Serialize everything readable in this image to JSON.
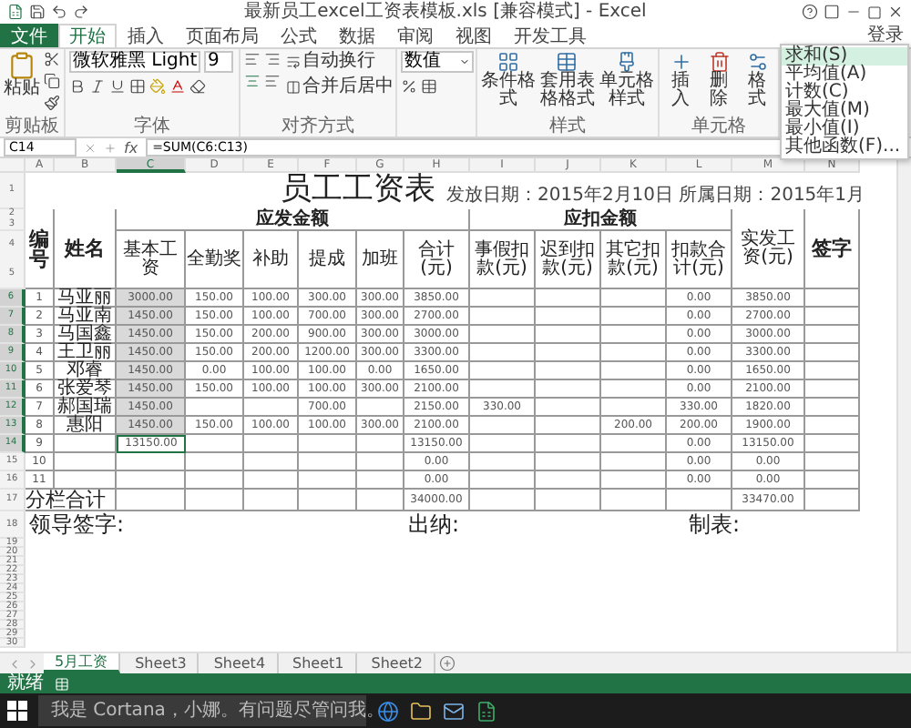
{
  "title_bar": {
    "title": "最新员工excel工资表模板.xls [兼容模式] - Excel",
    "login": "登录"
  },
  "tabs": [
    {
      "label": "文件",
      "kind": "file",
      "selected": false
    },
    {
      "label": "开始",
      "kind": "tab",
      "selected": true
    },
    {
      "label": "插入",
      "kind": "tab",
      "selected": false
    },
    {
      "label": "页面布局",
      "kind": "tab",
      "selected": false
    },
    {
      "label": "公式",
      "kind": "tab",
      "selected": false
    },
    {
      "label": "数据",
      "kind": "tab",
      "selected": false
    },
    {
      "label": "审阅",
      "kind": "tab",
      "selected": false
    },
    {
      "label": "视图",
      "kind": "tab",
      "selected": false
    },
    {
      "label": "开发工具",
      "kind": "tab",
      "selected": false
    }
  ],
  "ribbon": {
    "groups": [
      {
        "kind": "clipboard",
        "label": "剪贴板",
        "buttons": [
          "粘贴"
        ]
      },
      {
        "kind": "font",
        "label": "字体",
        "font_name": "微软雅黑 Light",
        "font_size": "9"
      },
      {
        "kind": "alignment",
        "label": "对齐方式",
        "buttons": [
          "自动换行",
          "合并后居中"
        ]
      },
      {
        "kind": "number",
        "number_format": "数值"
      },
      {
        "kind": "styles",
        "label": "样式",
        "buttons": [
          "条件格式",
          "套用表格格式",
          "单元格样式"
        ]
      },
      {
        "kind": "cells",
        "label": "单元格",
        "buttons": [
          "插入",
          "删除",
          "格式"
        ]
      }
    ]
  },
  "autosum_menu": {
    "items": [
      {
        "label": "求和(S)",
        "selected": true
      },
      {
        "label": "平均值(A)",
        "selected": false
      },
      {
        "label": "计数(C)",
        "selected": false
      },
      {
        "label": "最大值(M)",
        "selected": false
      },
      {
        "label": "最小值(I)",
        "selected": false
      },
      {
        "label": "其他函数(F)...",
        "selected": false
      }
    ]
  },
  "formula_bar": {
    "name_box": "C14",
    "fx_label": "fx",
    "formula": "=SUM(C6:C13)"
  },
  "columns": [
    {
      "label": "A",
      "selected": false
    },
    {
      "label": "B",
      "selected": false
    },
    {
      "label": "C",
      "selected": true
    },
    {
      "label": "D",
      "selected": false
    },
    {
      "label": "E",
      "selected": false
    },
    {
      "label": "F",
      "selected": false
    },
    {
      "label": "G",
      "selected": false
    },
    {
      "label": "H",
      "selected": false
    },
    {
      "label": "I",
      "selected": false
    },
    {
      "label": "J",
      "selected": false
    },
    {
      "label": "K",
      "selected": false
    },
    {
      "label": "L",
      "selected": false
    },
    {
      "label": "M",
      "selected": false
    },
    {
      "label": "N",
      "selected": false
    }
  ],
  "sheet": {
    "title": "员工工资表",
    "dates": "发放日期：2015年2月10日  所属日期：2015年1月",
    "header_row_numbers": [
      "1",
      "2",
      "3",
      "4",
      "5"
    ],
    "id_header": "编号",
    "name_header": "姓名",
    "group_headers": [
      "应发金额",
      "应扣金额"
    ],
    "headers": [
      "基本工资",
      "全勤奖",
      "补助",
      "提成",
      "加班",
      "合计(元)",
      "事假扣款(元)",
      "迟到扣款(元)",
      "其它扣款(元)",
      "扣款合计(元)"
    ],
    "net_header": "实发工资(元)",
    "sign_header": "签字",
    "rows": [
      {
        "row": "6",
        "selected": true,
        "active": false,
        "cells": [
          "1",
          "马亚丽",
          "3000.00",
          "150.00",
          "100.00",
          "300.00",
          "300.00",
          "3850.00",
          "",
          "",
          "",
          "0.00",
          "3850.00"
        ]
      },
      {
        "row": "7",
        "selected": true,
        "active": false,
        "cells": [
          "2",
          "马亚南",
          "1450.00",
          "150.00",
          "100.00",
          "700.00",
          "300.00",
          "2700.00",
          "",
          "",
          "",
          "0.00",
          "2700.00"
        ]
      },
      {
        "row": "8",
        "selected": true,
        "active": false,
        "cells": [
          "3",
          "马国鑫",
          "1450.00",
          "150.00",
          "200.00",
          "900.00",
          "300.00",
          "3000.00",
          "",
          "",
          "",
          "0.00",
          "3000.00"
        ]
      },
      {
        "row": "9",
        "selected": true,
        "active": false,
        "cells": [
          "4",
          "王卫丽",
          "1450.00",
          "150.00",
          "200.00",
          "1200.00",
          "300.00",
          "3300.00",
          "",
          "",
          "",
          "0.00",
          "3300.00"
        ]
      },
      {
        "row": "10",
        "selected": true,
        "active": false,
        "cells": [
          "5",
          "邓睿",
          "1450.00",
          "0.00",
          "100.00",
          "100.00",
          "0.00",
          "1650.00",
          "",
          "",
          "",
          "0.00",
          "1650.00"
        ]
      },
      {
        "row": "11",
        "selected": true,
        "active": false,
        "cells": [
          "6",
          "张爱琴",
          "1450.00",
          "150.00",
          "100.00",
          "100.00",
          "300.00",
          "2100.00",
          "",
          "",
          "",
          "0.00",
          "2100.00"
        ]
      },
      {
        "row": "12",
        "selected": true,
        "active": false,
        "cells": [
          "7",
          "郝国瑞",
          "1450.00",
          "",
          "",
          "700.00",
          "",
          "2150.00",
          "330.00",
          "",
          "",
          "330.00",
          "1820.00"
        ]
      },
      {
        "row": "13",
        "selected": true,
        "active": false,
        "cells": [
          "8",
          "惠阳",
          "1450.00",
          "150.00",
          "100.00",
          "100.00",
          "300.00",
          "2100.00",
          "",
          "",
          "200.00",
          "200.00",
          "1900.00"
        ]
      },
      {
        "row": "14",
        "selected": true,
        "active": true,
        "cells": [
          "9",
          "",
          "13150.00",
          "",
          "",
          "",
          "",
          "13150.00",
          "",
          "",
          "",
          "0.00",
          "13150.00"
        ]
      },
      {
        "row": "15",
        "selected": false,
        "active": false,
        "cells": [
          "10",
          "",
          "",
          "",
          "",
          "",
          "",
          "0.00",
          "",
          "",
          "",
          "0.00",
          "0.00"
        ]
      },
      {
        "row": "16",
        "selected": false,
        "active": false,
        "cells": [
          "11",
          "",
          "",
          "",
          "",
          "",
          "",
          "0.00",
          "",
          "",
          "",
          "0.00",
          "0.00"
        ]
      }
    ],
    "total": {
      "row": "17",
      "label": "分栏合计",
      "cells": [
        "",
        "",
        "",
        "",
        "",
        "34000.00",
        "",
        "",
        "",
        "",
        "33470.00"
      ]
    },
    "signatures": {
      "row": "18",
      "items": [
        "领导签字:",
        "出纳:",
        "制表:"
      ]
    },
    "empty_rows": [
      "19",
      "20",
      "21",
      "22",
      "23",
      "24",
      "25",
      "26",
      "27",
      "28",
      "29",
      "30"
    ]
  },
  "sheet_tabs": [
    {
      "label": "5月工资",
      "selected": true
    },
    {
      "label": "Sheet3",
      "selected": false
    },
    {
      "label": "Sheet4",
      "selected": false
    },
    {
      "label": "Sheet1",
      "selected": false
    },
    {
      "label": "Sheet2",
      "selected": false
    }
  ],
  "status_bar": {
    "text": "就绪"
  },
  "taskbar": {
    "search": "我是 Cortana，小娜。有问题尽管问我。"
  }
}
